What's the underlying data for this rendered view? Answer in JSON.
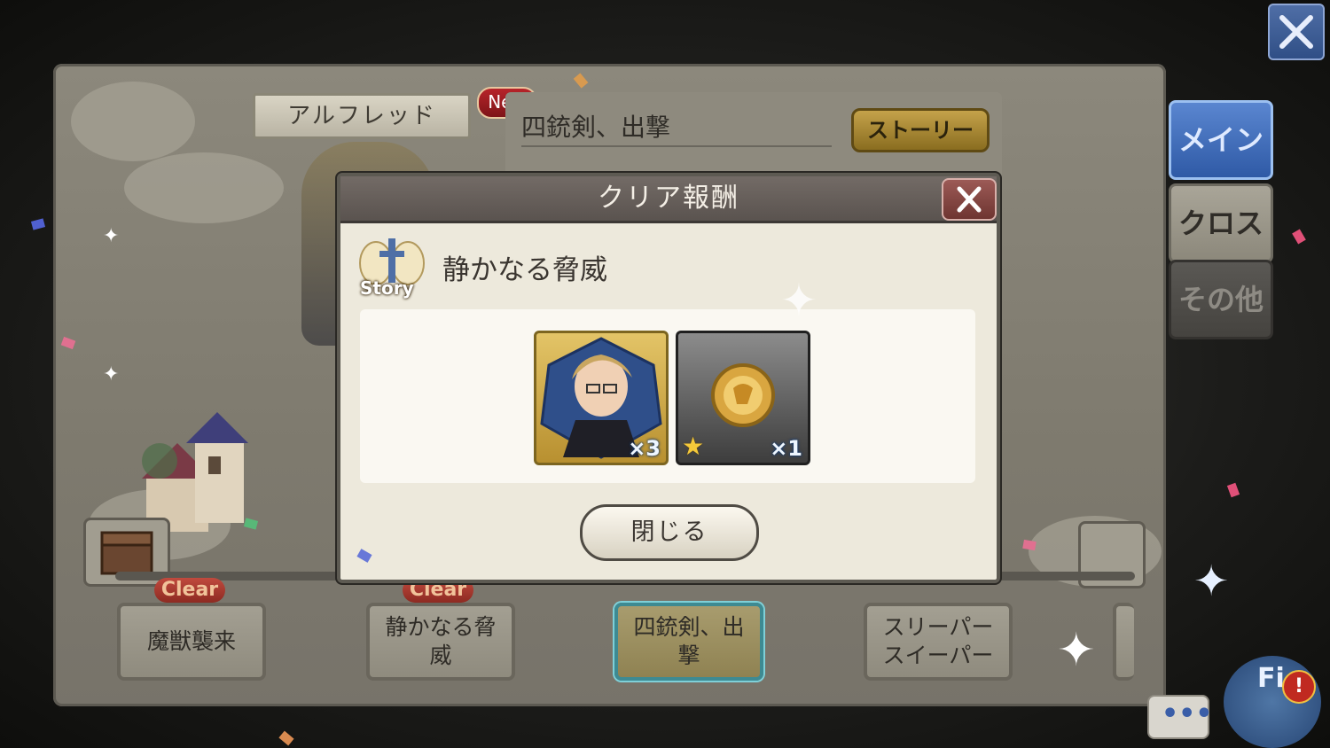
{
  "header": {
    "character_name": "アルフレッド",
    "new_badge": "New",
    "chapter_title": "四銃剣、出撃",
    "story_button": "ストーリー"
  },
  "side_tabs": [
    {
      "label": "メイン",
      "selected": true
    },
    {
      "label": "クロス",
      "selected": false
    },
    {
      "label": "その他",
      "selected": false
    }
  ],
  "stages": [
    {
      "label": "魔獣襲来",
      "status": "Clear"
    },
    {
      "label": "静かなる脅威",
      "status": "Clear"
    },
    {
      "label": "四銃剣、出撃",
      "status": "current"
    },
    {
      "label": "スリーパースイーパー",
      "status": ""
    }
  ],
  "modal": {
    "title": "クリア報酬",
    "story_icon_label": "Story",
    "quest_title": "静かなる脅威",
    "rewards": [
      {
        "kind": "character",
        "icon": "character-portrait-icon",
        "qty": "×3"
      },
      {
        "kind": "item",
        "icon": "gold-coin-icon",
        "qty": "×1",
        "rarity_star": true
      }
    ],
    "close_button": "閉じる"
  },
  "field_button": {
    "label": "Fi"
  },
  "colors": {
    "modal_header": "#5a534f",
    "tab_main": "#2f5aa6",
    "story_button": "#c4a24a",
    "clear_tag": "#c04a3e"
  }
}
